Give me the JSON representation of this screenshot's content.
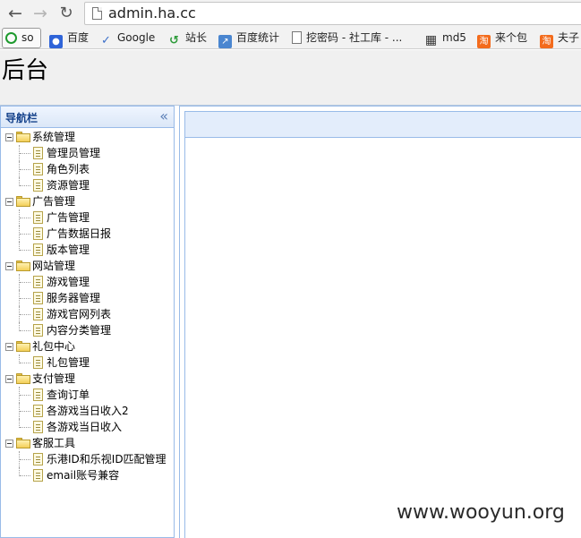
{
  "browser": {
    "url": "admin.ha.cc",
    "bookmarks": [
      {
        "label": "so",
        "icon": "360-search-icon"
      },
      {
        "label": "百度",
        "icon": "baidu-paw-icon"
      },
      {
        "label": "Google",
        "icon": "google-icon"
      },
      {
        "label": "站长",
        "icon": "cnzz-icon"
      },
      {
        "label": "百度统计",
        "icon": "chart-icon"
      },
      {
        "label": "挖密码 - 社工库 - ...",
        "icon": "page-icon"
      },
      {
        "label": "md5",
        "icon": "grid-icon"
      },
      {
        "label": "来个包",
        "icon": "taobao-icon"
      },
      {
        "label": "夫子",
        "icon": "taobao-icon"
      }
    ]
  },
  "header": {
    "title": "后台"
  },
  "nav": {
    "title": "导航栏",
    "collapse_symbol": "«",
    "groups": [
      {
        "label": "系统管理",
        "items": [
          "管理员管理",
          "角色列表",
          "资源管理"
        ]
      },
      {
        "label": "广告管理",
        "items": [
          "广告管理",
          "广告数据日报",
          "版本管理"
        ]
      },
      {
        "label": "网站管理",
        "items": [
          "游戏管理",
          "服务器管理",
          "游戏官网列表",
          "内容分类管理"
        ]
      },
      {
        "label": "礼包中心",
        "items": [
          "礼包管理"
        ]
      },
      {
        "label": "支付管理",
        "items": [
          "查询订单",
          "各游戏当日收入2",
          "各游戏当日收入"
        ]
      },
      {
        "label": "客服工具",
        "items": [
          "乐港ID和乐视ID匹配管理",
          "email账号兼容"
        ]
      }
    ]
  },
  "colors": {
    "panel_border": "#99bbe8",
    "nav_title": "#15428b",
    "tabstrip": "#e3edfb"
  },
  "watermark": "www.wooyun.org"
}
